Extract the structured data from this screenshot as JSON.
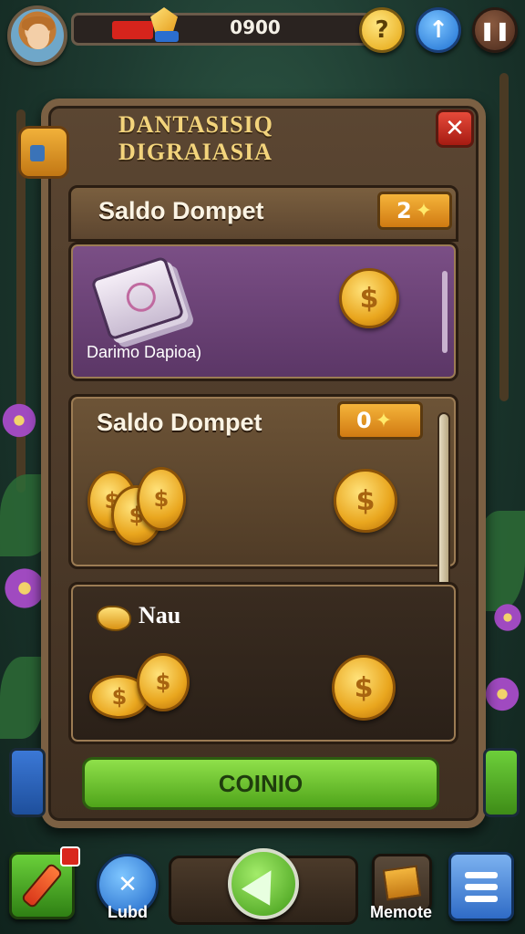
{
  "hud": {
    "score": "0900",
    "health_fraction": 0.14,
    "help_label": "?",
    "up_label": "↑",
    "pause_label": "❚❚"
  },
  "dialog": {
    "title": "DANTASISIQ DIGRAIASIA",
    "close_label": "✕",
    "sections": [
      {
        "title": "Saldo Dompet",
        "badge_value": "2",
        "caption": "Darimo Dapioa)",
        "coin_symbol": "$"
      },
      {
        "title": "Saldo Dompet",
        "badge_value": "0",
        "coin_symbol": "$"
      },
      {
        "title": "Nau",
        "coin_symbol": "$"
      }
    ],
    "confirm_label": "COINIO"
  },
  "dock": {
    "globe_label": "Lubd",
    "chest_label": "Memote"
  },
  "colors": {
    "accent_green": "#4fa41a",
    "title_gold": "#f3d47c",
    "close_red": "#d9261c"
  },
  "icons": [
    "avatar-icon",
    "gem-icon",
    "help-icon",
    "arrow-up-icon",
    "pause-icon",
    "close-icon",
    "backpack-icon",
    "card-deck-icon",
    "coin-icon",
    "gold-nugget-icon",
    "potion-icon",
    "globe-icon",
    "arrow-icon",
    "chest-icon",
    "menu-icon"
  ]
}
